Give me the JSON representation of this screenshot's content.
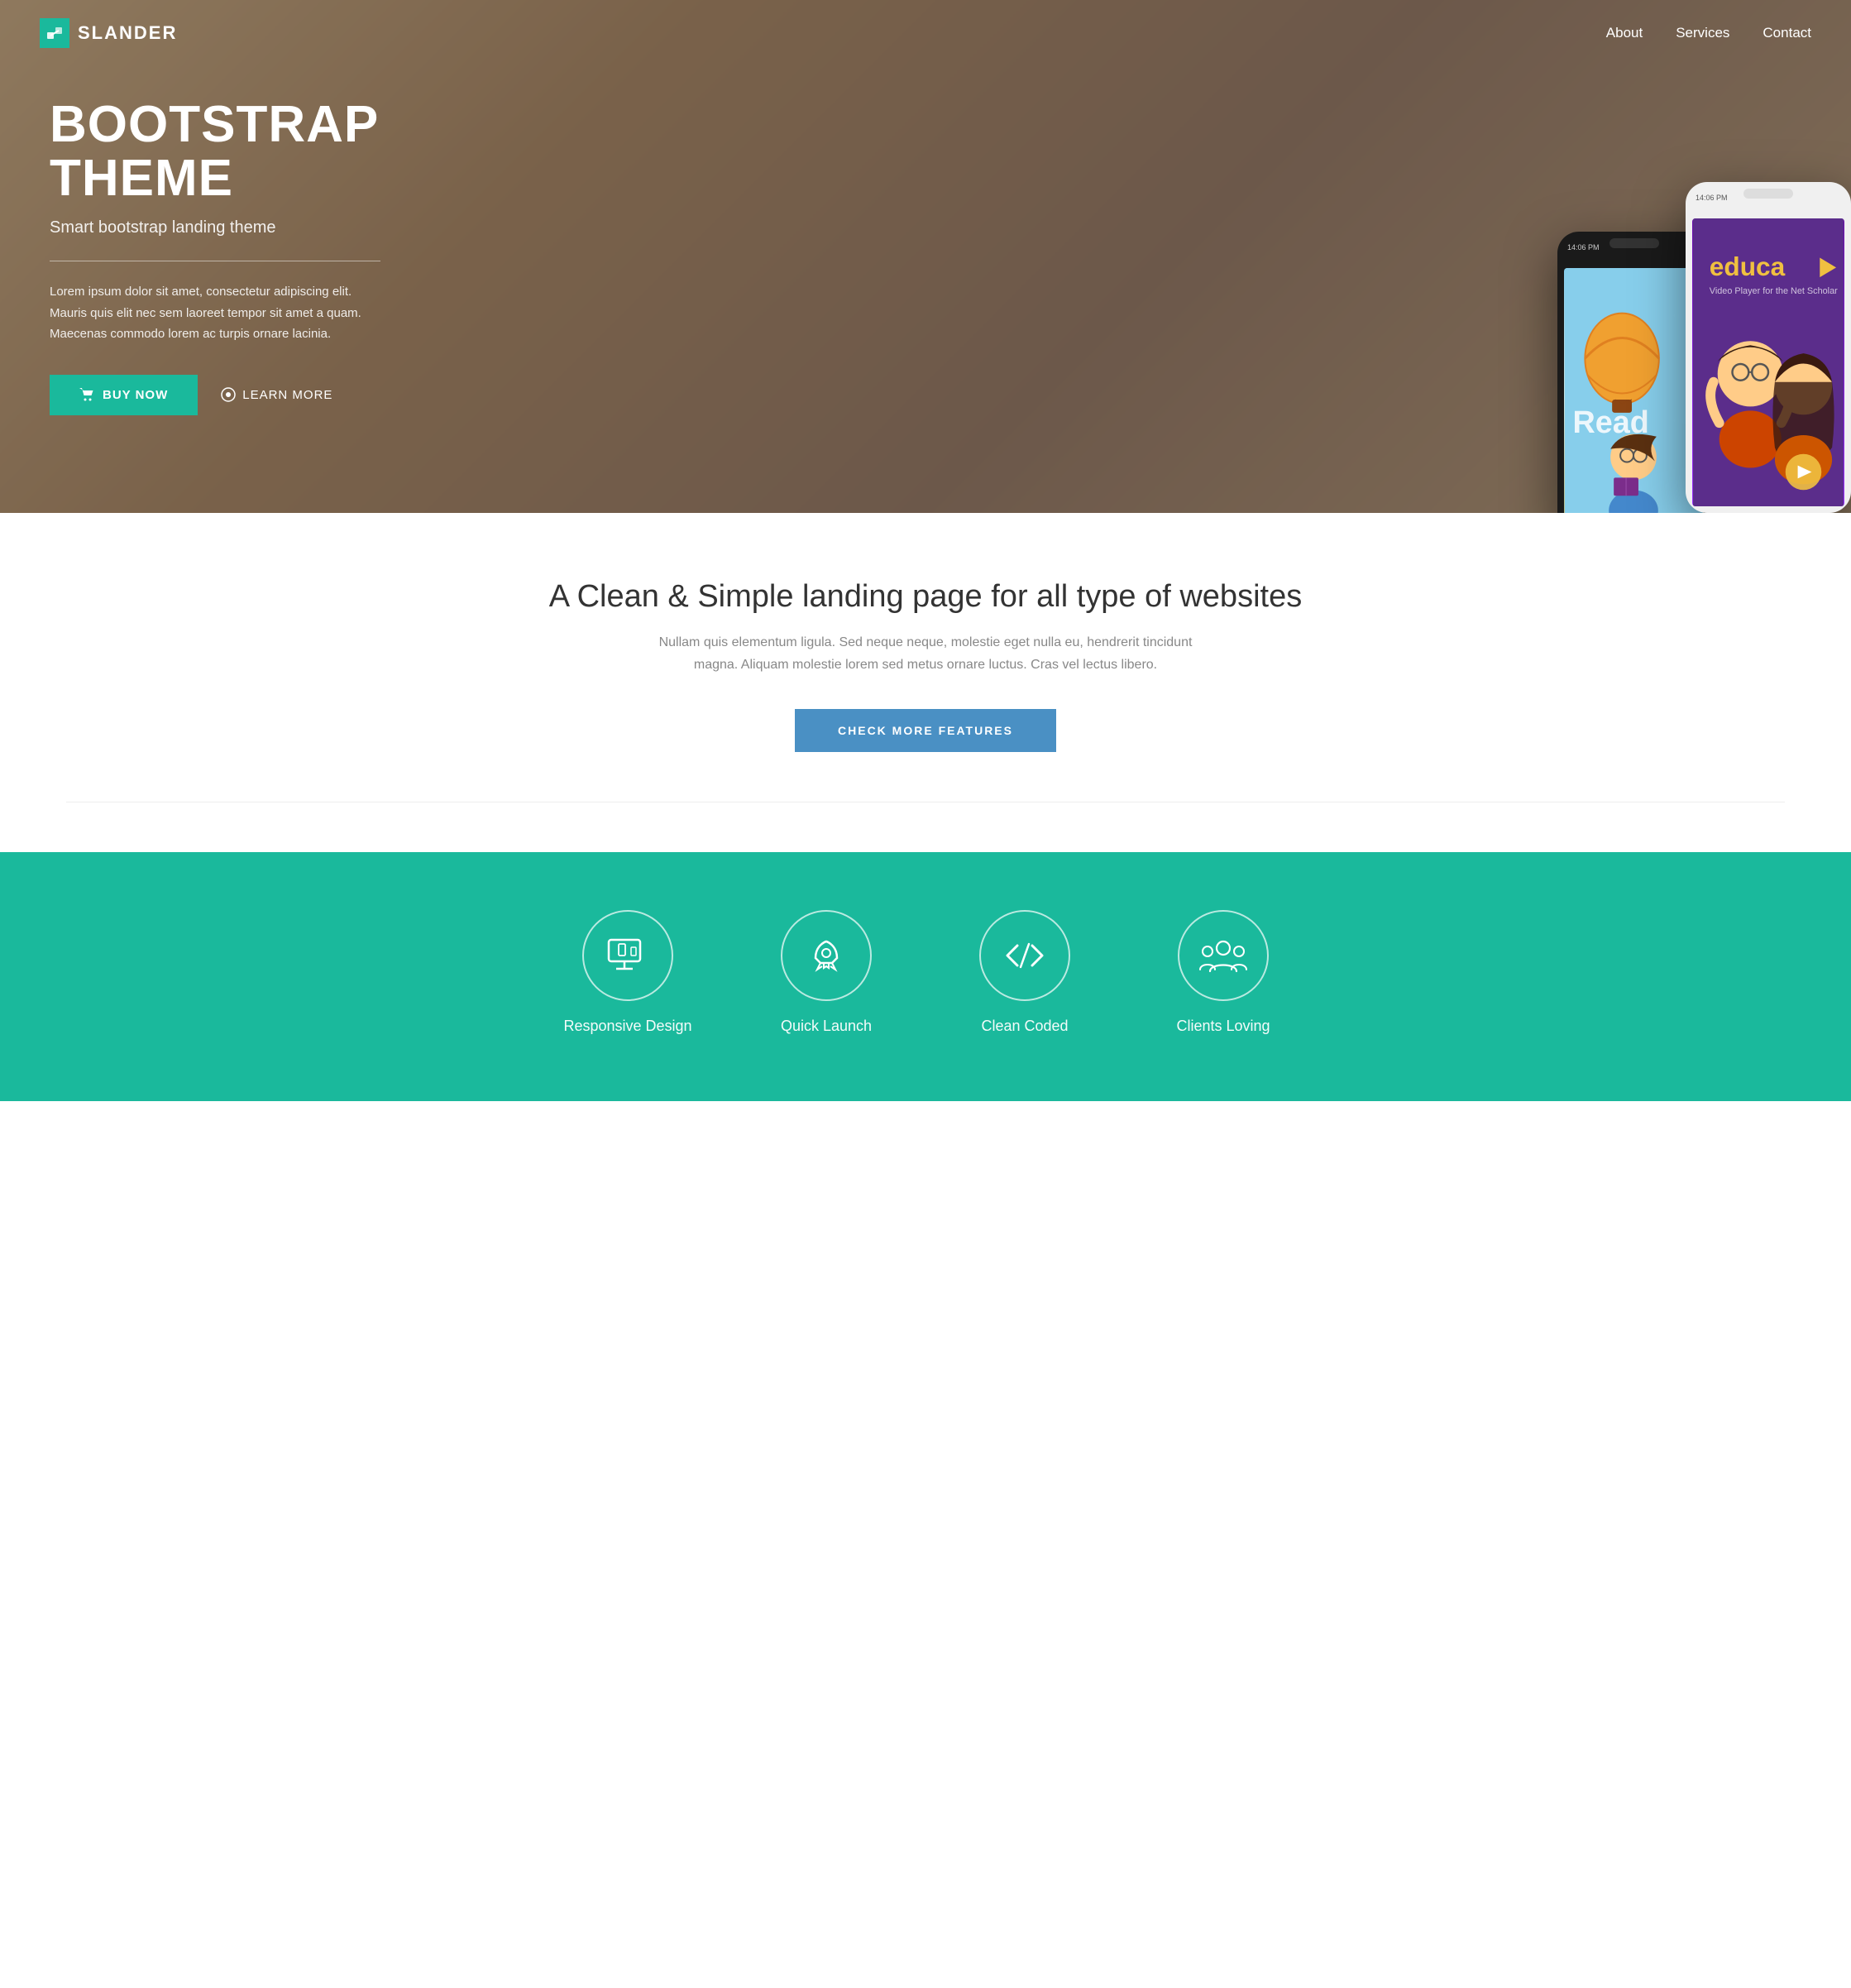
{
  "navbar": {
    "logo_text": "SLANDER",
    "logo_symbol": "✓",
    "nav_links": [
      {
        "label": "About",
        "href": "#about"
      },
      {
        "label": "Services",
        "href": "#services"
      },
      {
        "label": "Contact",
        "href": "#contact"
      }
    ]
  },
  "hero": {
    "title_line1": "BOOTSTRAP",
    "title_line2": "THEME",
    "subtitle": "Smart bootstrap landing theme",
    "body_text": "Lorem ipsum dolor sit amet, consectetur adipiscing elit. Mauris quis elit nec sem laoreet tempor sit amet a quam. Maecenas commodo lorem ac turpis ornare lacinia.",
    "btn_buy_label": "BUY NOW",
    "btn_learn_label": "LEARN MORE",
    "phone1_time": "14:06 PM",
    "phone2_time": "14:06 PM",
    "phone1_app": "Read",
    "phone2_app": "educa ▶"
  },
  "section_features": {
    "heading": "A Clean & Simple landing page for all type of websites",
    "subtext": "Nullam quis elementum ligula. Sed neque neque, molestie eget nulla eu, hendrerit tincidunt magna. Aliquam molestie lorem sed metus ornare luctus. Cras vel lectus libero.",
    "btn_label": "CHECK MORE FEATURES"
  },
  "icons_section": {
    "items": [
      {
        "label": "Responsive Design",
        "icon": "monitor"
      },
      {
        "label": "Quick Launch",
        "icon": "rocket"
      },
      {
        "label": "Clean Coded",
        "icon": "code"
      },
      {
        "label": "Clients Loving",
        "icon": "people"
      }
    ]
  }
}
